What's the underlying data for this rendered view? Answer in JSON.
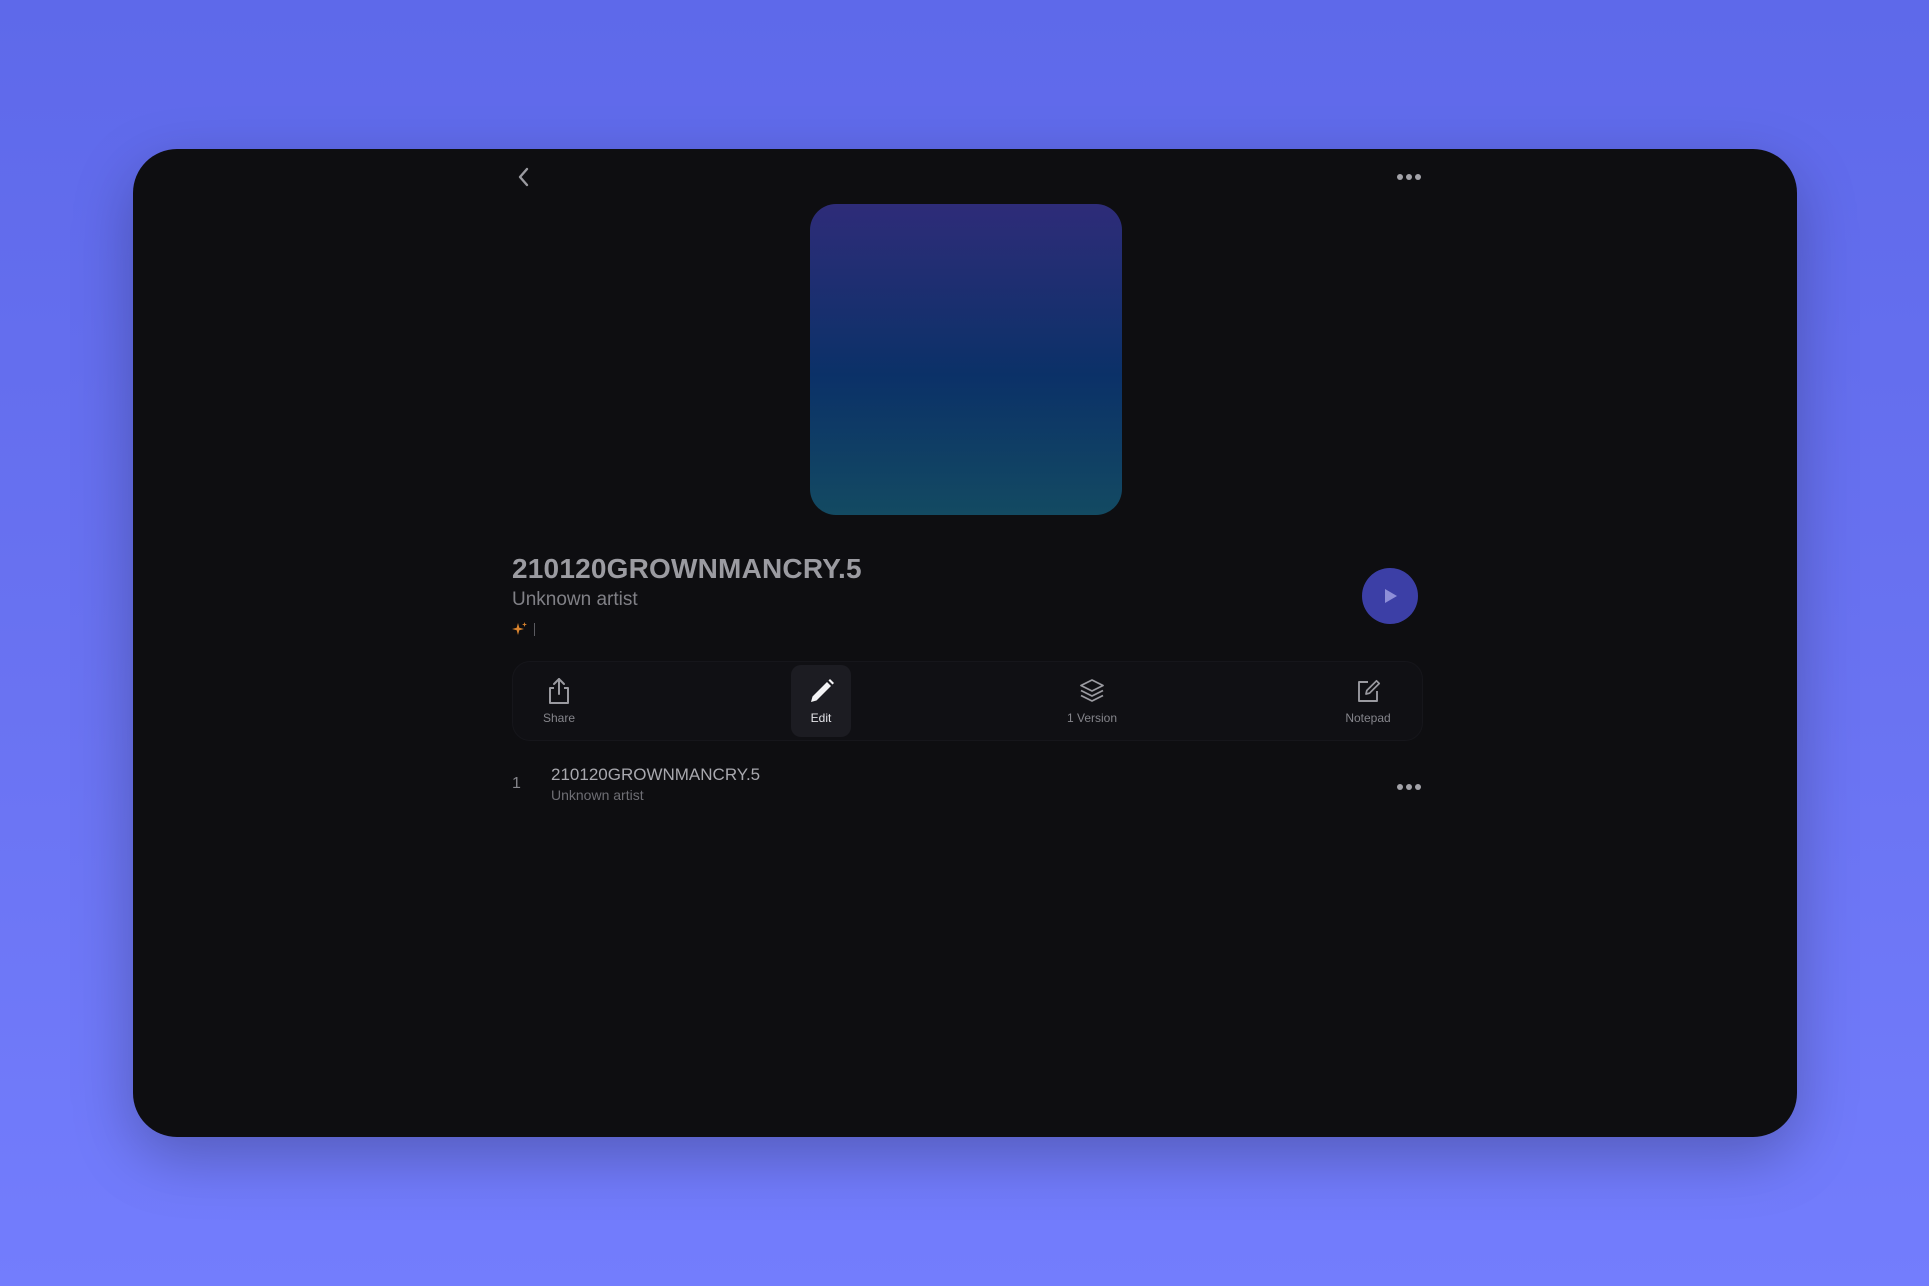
{
  "album": {
    "title": "210120GROWNMANCRY.5",
    "artist": "Unknown artist"
  },
  "actions": {
    "share_label": "Share",
    "edit_label": "Edit",
    "versions_label": "1 Version",
    "notepad_label": "Notepad"
  },
  "tracks": [
    {
      "number": "1",
      "title": "210120GROWNMANCRY.5",
      "artist": "Unknown artist"
    }
  ],
  "colors": {
    "background_top": "#5e69ea",
    "background_bottom": "#737dfd",
    "device_background": "#0e0e11",
    "play_button": "#3c3fa6",
    "artwork_top": "#2e2c79",
    "artwork_bottom": "#134a62",
    "sparkle_accent": "#d9832e"
  },
  "icons": {
    "back": "chevron-left-icon",
    "more": "ellipsis-horizontal-icon",
    "play": "play-icon",
    "share": "share-icon",
    "edit": "pencil-icon",
    "versions": "layers-icon",
    "notepad": "note-edit-icon",
    "meta": "sparkle-icon"
  }
}
